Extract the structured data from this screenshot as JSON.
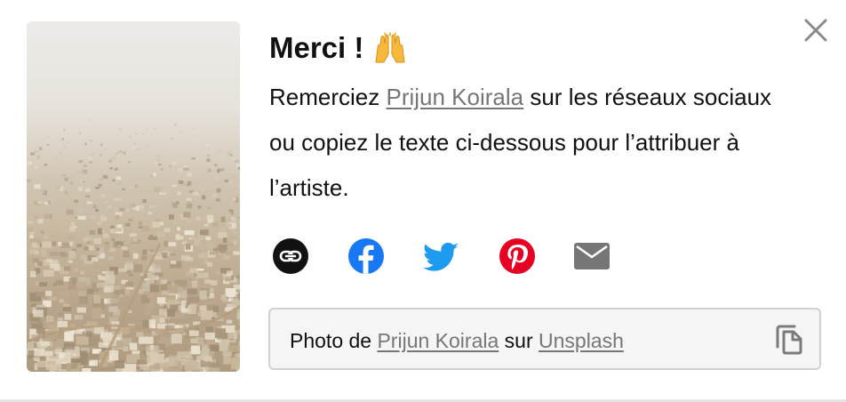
{
  "dialog": {
    "title": "Merci !",
    "title_emoji": "raising-hands-emoji",
    "message": {
      "before": "Remerciez ",
      "author": "Prijun Koirala",
      "after": " sur les réseaux sociaux ou copiez le texte ci-dessous pour l’attribuer à l’artiste."
    },
    "close_icon": "close-icon"
  },
  "share": {
    "items": [
      {
        "name": "link",
        "icon": "link-icon",
        "color": "#111111"
      },
      {
        "name": "facebook",
        "icon": "facebook-icon",
        "color": "#1877f2"
      },
      {
        "name": "twitter",
        "icon": "twitter-icon",
        "color": "#1d9bf0"
      },
      {
        "name": "pinterest",
        "icon": "pinterest-icon",
        "color": "#e60023"
      },
      {
        "name": "email",
        "icon": "email-icon",
        "color": "#767676"
      }
    ]
  },
  "attribution": {
    "prefix": "Photo de ",
    "author": "Prijun Koirala",
    "middle": " sur ",
    "site": "Unsplash",
    "copy_icon": "copy-icon"
  },
  "colors": {
    "link_text": "#767676",
    "box_border": "#d1d1d1",
    "box_background": "#f5f5f5",
    "close_icon": "#8a8a8a"
  }
}
